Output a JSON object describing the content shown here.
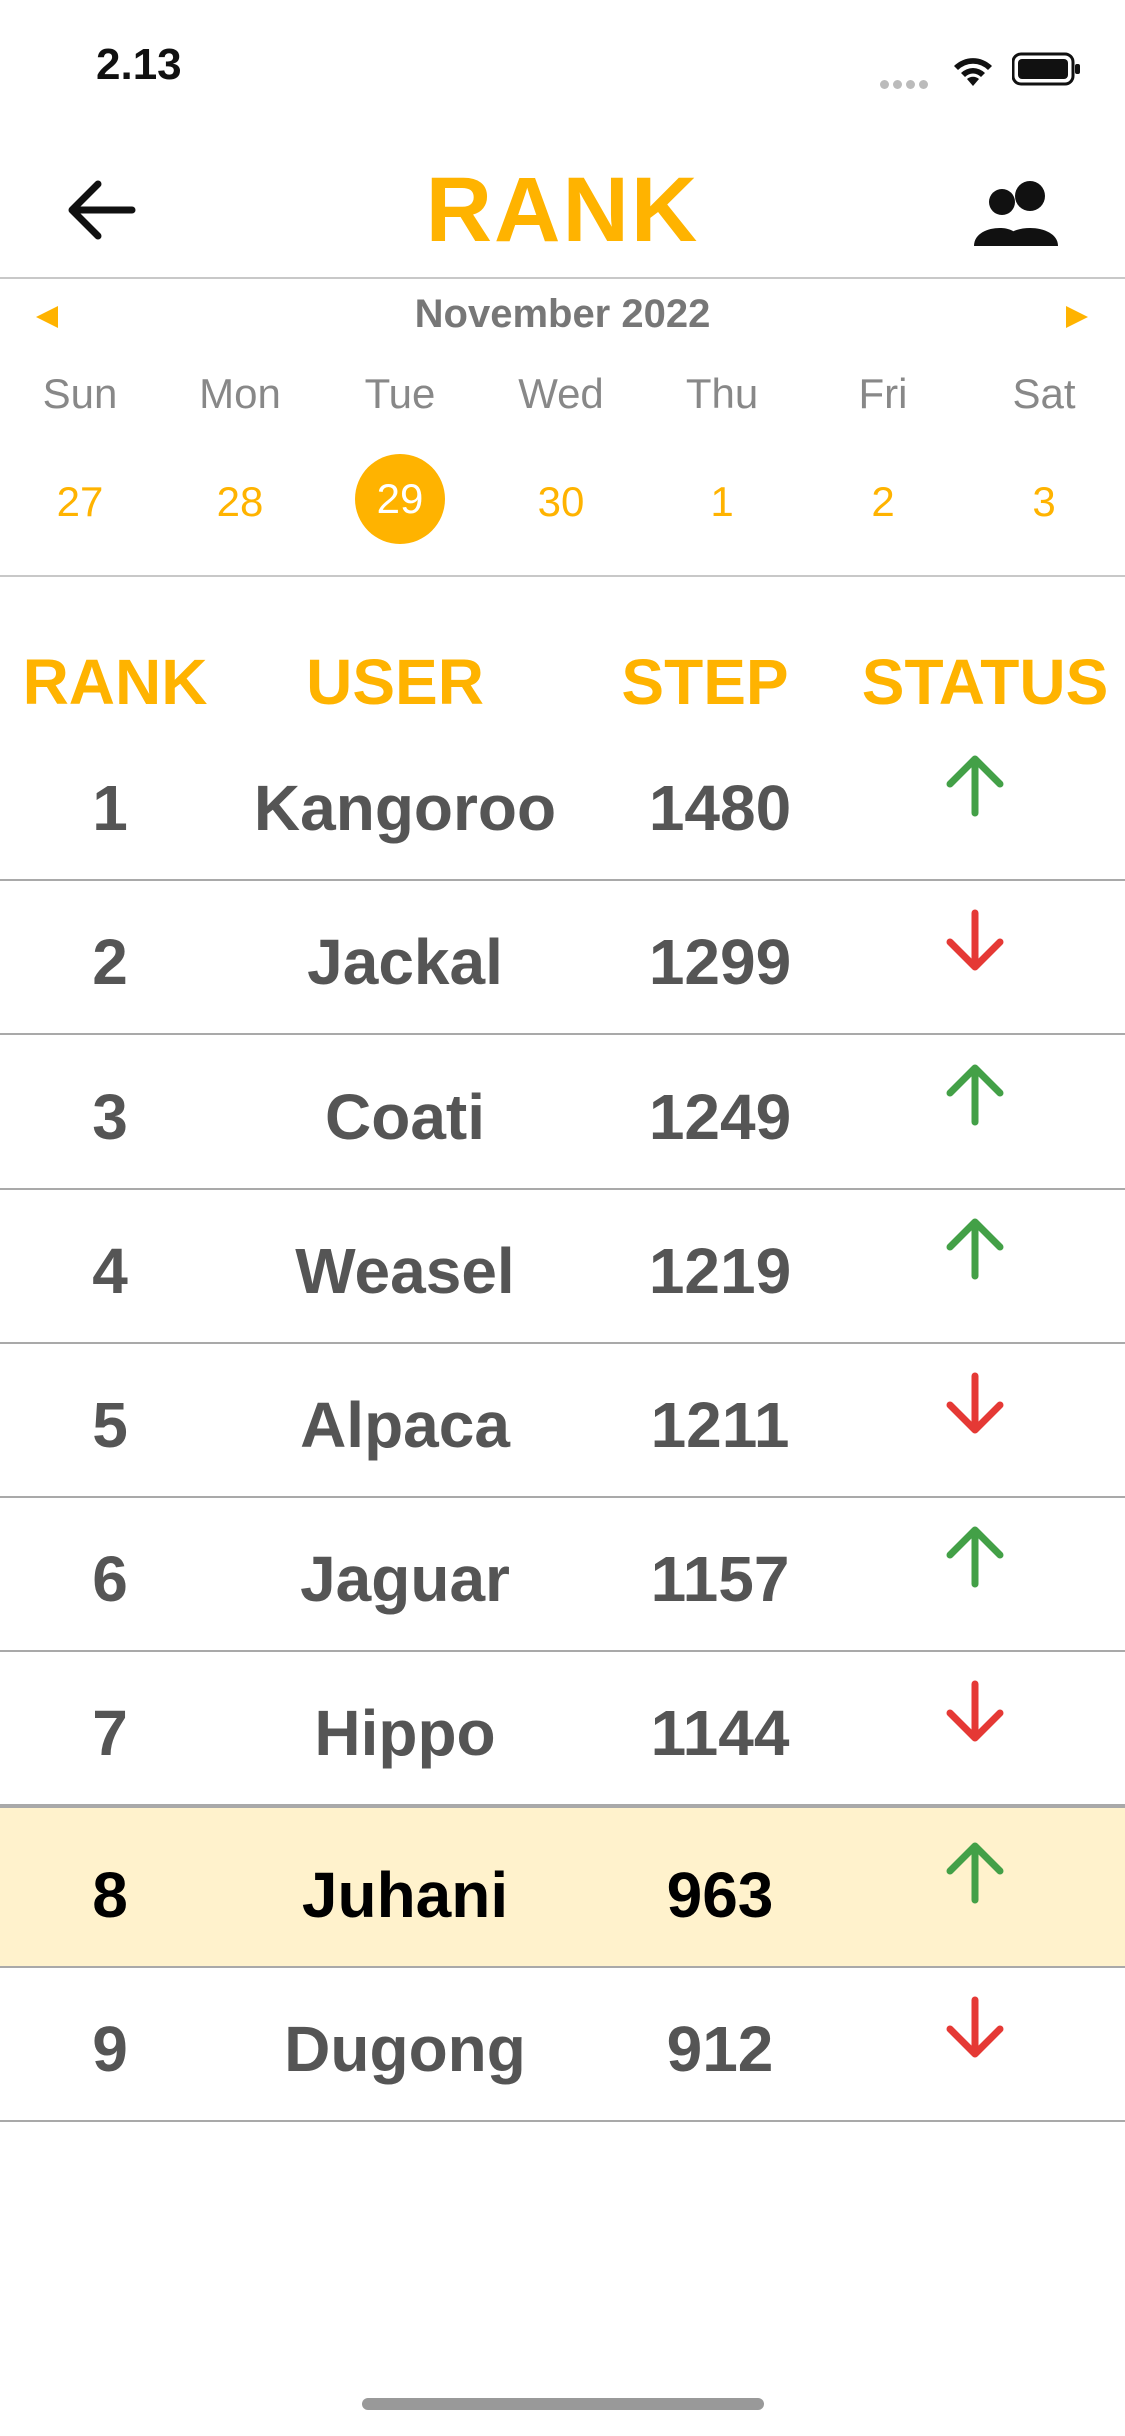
{
  "status_bar": {
    "time": "2.13"
  },
  "header": {
    "title": "RANK"
  },
  "calendar": {
    "month": "November 2022",
    "weekdays": [
      "Sun",
      "Mon",
      "Tue",
      "Wed",
      "Thu",
      "Fri",
      "Sat"
    ],
    "days": [
      "27",
      "28",
      "29",
      "30",
      "1",
      "2",
      "3"
    ],
    "selected_day": "29"
  },
  "table": {
    "headers": [
      "RANK",
      "USER",
      "STEP",
      "STATUS"
    ],
    "rows": [
      {
        "rank": "1",
        "user": "Kangoroo",
        "step": "1480",
        "status": "up"
      },
      {
        "rank": "2",
        "user": "Jackal",
        "step": "1299",
        "status": "down"
      },
      {
        "rank": "3",
        "user": "Coati",
        "step": "1249",
        "status": "up"
      },
      {
        "rank": "4",
        "user": "Weasel",
        "step": "1219",
        "status": "up"
      },
      {
        "rank": "5",
        "user": "Alpaca",
        "step": "1211",
        "status": "down"
      },
      {
        "rank": "6",
        "user": "Jaguar",
        "step": "1157",
        "status": "up"
      },
      {
        "rank": "7",
        "user": "Hippo",
        "step": "1144",
        "status": "down"
      },
      {
        "rank": "8",
        "user": "Juhani",
        "step": "963",
        "status": "up",
        "highlighted": true
      },
      {
        "rank": "9",
        "user": "Dugong",
        "step": "912",
        "status": "down"
      }
    ]
  },
  "colors": {
    "accent": "#FFB300",
    "up": "#43A047",
    "down": "#E53935",
    "highlight_row": "#FFF2CC"
  },
  "icons": {
    "back": "arrow-left-icon",
    "friends": "people-icon",
    "prev": "triangle-left-icon",
    "next": "triangle-right-icon",
    "up": "arrow-up-icon",
    "down": "arrow-down-icon"
  }
}
